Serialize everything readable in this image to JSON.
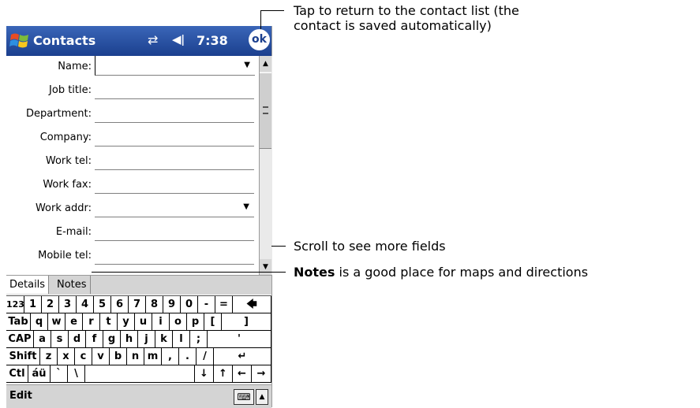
{
  "titlebar": {
    "app_title": "Contacts",
    "start_icon": "windows-flag-icon",
    "connectivity_icon": "connectivity-icon",
    "volume_icon": "speaker-icon",
    "time": "7:38",
    "ok_label": "ok"
  },
  "form": {
    "fields": [
      {
        "label": "Name:",
        "dropdown": true
      },
      {
        "label": "Job title:"
      },
      {
        "label": "Department:"
      },
      {
        "label": "Company:"
      },
      {
        "label": "Work tel:"
      },
      {
        "label": "Work fax:"
      },
      {
        "label": "Work addr:",
        "dropdown": true
      },
      {
        "label": "E-mail:"
      },
      {
        "label": "Mobile tel:"
      }
    ]
  },
  "tabs": {
    "details": "Details",
    "notes": "Notes"
  },
  "keyboard": {
    "row1": [
      "123",
      "1",
      "2",
      "3",
      "4",
      "5",
      "6",
      "7",
      "8",
      "9",
      "0",
      "-",
      "=",
      "🡄"
    ],
    "row2": [
      "Tab",
      "q",
      "w",
      "e",
      "r",
      "t",
      "y",
      "u",
      "i",
      "o",
      "p",
      "[",
      "]"
    ],
    "row3": [
      "CAP",
      "a",
      "s",
      "d",
      "f",
      "g",
      "h",
      "j",
      "k",
      "l",
      ";",
      "'"
    ],
    "row4": [
      "Shift",
      "z",
      "x",
      "c",
      "v",
      "b",
      "n",
      "m",
      ",",
      ".",
      "/",
      "↵"
    ],
    "row5": [
      "Ctl",
      "áü",
      "`",
      "\\",
      "",
      "↓",
      "↑",
      "←",
      "→"
    ]
  },
  "menubar": {
    "edit_label": "Edit",
    "keyboard_icon": "keyboard-icon",
    "sip_arrow": "▲"
  },
  "callouts": {
    "ok": "Tap to return to the contact list (the contact is saved automatically)",
    "ok_line1": "Tap to return to the contact list (the",
    "ok_line2": "contact is saved automatically)",
    "scroll": "Scroll to see more fields",
    "notes_bold": "Notes",
    "notes_rest": " is a good place for maps and directions"
  }
}
